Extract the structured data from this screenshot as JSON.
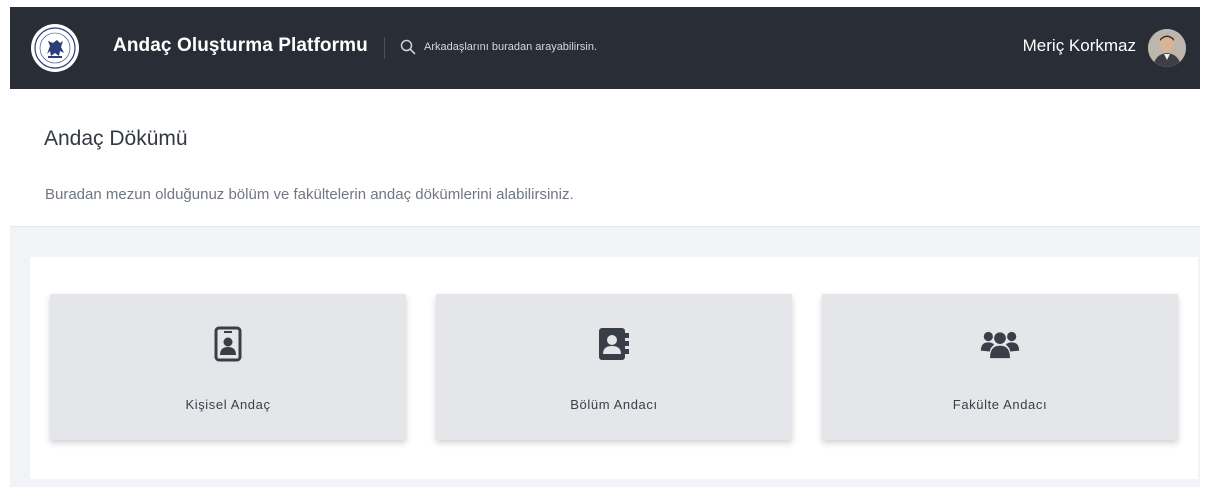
{
  "header": {
    "title": "Andaç Oluşturma Platformu",
    "search_placeholder": "Arkadaşlarını buradan arayabilirsin.",
    "user_name": "Meriç Korkmaz",
    "logo_icon": "university-seal-icon",
    "avatar_icon": "user-avatar"
  },
  "page": {
    "title": "Andaç Dökümü",
    "description": "Buradan mezun olduğunuz bölüm ve fakültelerin andaç dökümlerini alabilirsiniz."
  },
  "cards": [
    {
      "label": "Kişisel Andaç",
      "icon": "id-badge-icon"
    },
    {
      "label": "Bölüm Andacı",
      "icon": "address-book-icon"
    },
    {
      "label": "Fakülte Andacı",
      "icon": "users-icon"
    }
  ],
  "colors": {
    "navbar": "#282d36",
    "card_bg": "#e4e6e9",
    "section_bg": "#f2f3f6",
    "icon": "#3a3f47"
  }
}
